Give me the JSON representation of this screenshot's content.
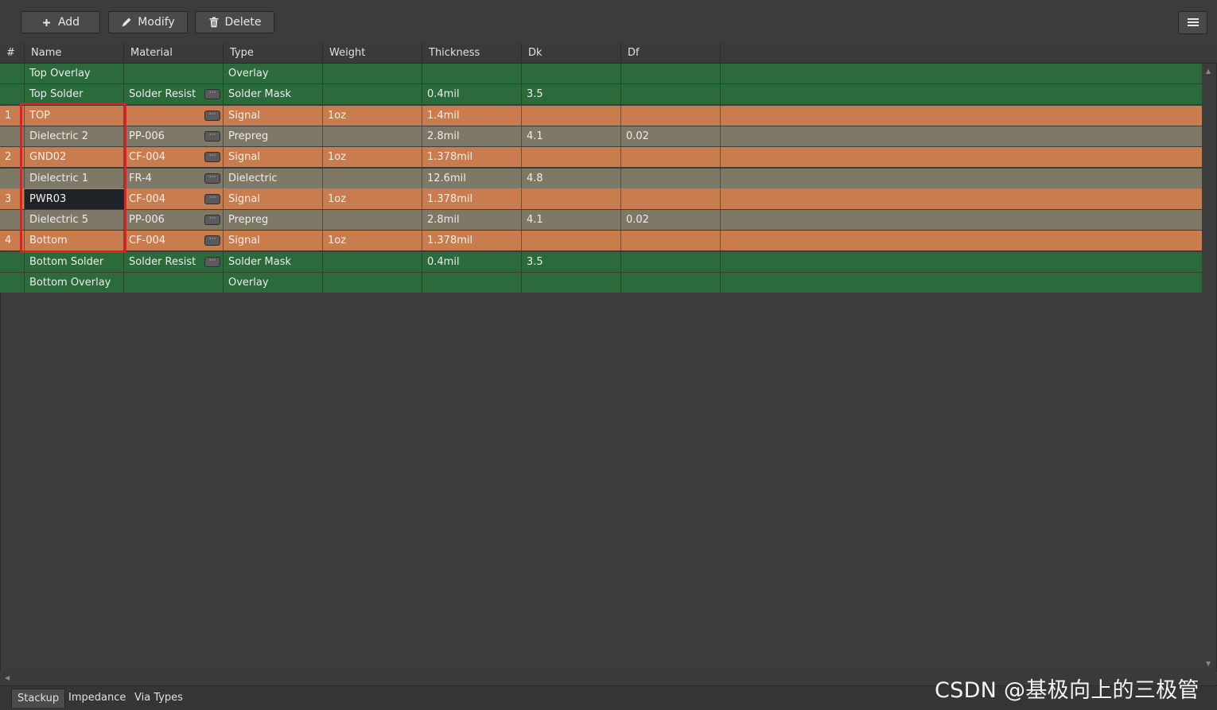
{
  "toolbar": {
    "add_label": "Add",
    "modify_label": "Modify",
    "delete_label": "Delete"
  },
  "columns": [
    "#",
    "Name",
    "Material",
    "Type",
    "Weight",
    "Thickness",
    "Dk",
    "Df"
  ],
  "rows": [
    {
      "num": "",
      "name": "Top Overlay",
      "material": "",
      "type": "Overlay",
      "weight": "",
      "thickness": "",
      "dk": "",
      "df": "",
      "color": "green",
      "has_picker": false
    },
    {
      "num": "",
      "name": "Top Solder",
      "material": "Solder Resist",
      "type": "Solder Mask",
      "weight": "",
      "thickness": "0.4mil",
      "dk": "3.5",
      "df": "",
      "color": "green",
      "has_picker": true
    },
    {
      "num": "1",
      "name": "TOP",
      "material": "",
      "type": "Signal",
      "weight": "1oz",
      "thickness": "1.4mil",
      "dk": "",
      "df": "",
      "color": "orange",
      "has_picker": true
    },
    {
      "num": "",
      "name": "Dielectric 2",
      "material": "PP-006",
      "type": "Prepreg",
      "weight": "",
      "thickness": "2.8mil",
      "dk": "4.1",
      "df": "0.02",
      "color": "gray",
      "has_picker": true
    },
    {
      "num": "2",
      "name": "GND02",
      "material": "CF-004",
      "type": "Signal",
      "weight": "1oz",
      "thickness": "1.378mil",
      "dk": "",
      "df": "",
      "color": "orange",
      "has_picker": true
    },
    {
      "num": "",
      "name": "Dielectric 1",
      "material": "FR-4",
      "type": "Dielectric",
      "weight": "",
      "thickness": "12.6mil",
      "dk": "4.8",
      "df": "",
      "color": "gray",
      "has_picker": true
    },
    {
      "num": "3",
      "name": "PWR03",
      "material": "CF-004",
      "type": "Signal",
      "weight": "1oz",
      "thickness": "1.378mil",
      "dk": "",
      "df": "",
      "color": "orange",
      "has_picker": true,
      "selected": true
    },
    {
      "num": "",
      "name": "Dielectric 5",
      "material": "PP-006",
      "type": "Prepreg",
      "weight": "",
      "thickness": "2.8mil",
      "dk": "4.1",
      "df": "0.02",
      "color": "gray",
      "has_picker": true
    },
    {
      "num": "4",
      "name": "Bottom",
      "material": "CF-004",
      "type": "Signal",
      "weight": "1oz",
      "thickness": "1.378mil",
      "dk": "",
      "df": "",
      "color": "orange",
      "has_picker": true
    },
    {
      "num": "",
      "name": "Bottom Solder",
      "material": "Solder Resist",
      "type": "Solder Mask",
      "weight": "",
      "thickness": "0.4mil",
      "dk": "3.5",
      "df": "",
      "color": "green",
      "has_picker": true
    },
    {
      "num": "",
      "name": "Bottom Overlay",
      "material": "",
      "type": "Overlay",
      "weight": "",
      "thickness": "",
      "dk": "",
      "df": "",
      "color": "green",
      "has_picker": false
    }
  ],
  "picker_label": "···",
  "tabs": [
    {
      "label": "Stackup",
      "active": true
    },
    {
      "label": "Impedance",
      "active": false
    },
    {
      "label": "Via Types",
      "active": false
    }
  ],
  "watermark": "CSDN @基极向上的三极管",
  "colors": {
    "green": "#2a6a3b",
    "orange": "#c97c4d",
    "gray": "#7e7866",
    "highlight": "#e02020"
  }
}
